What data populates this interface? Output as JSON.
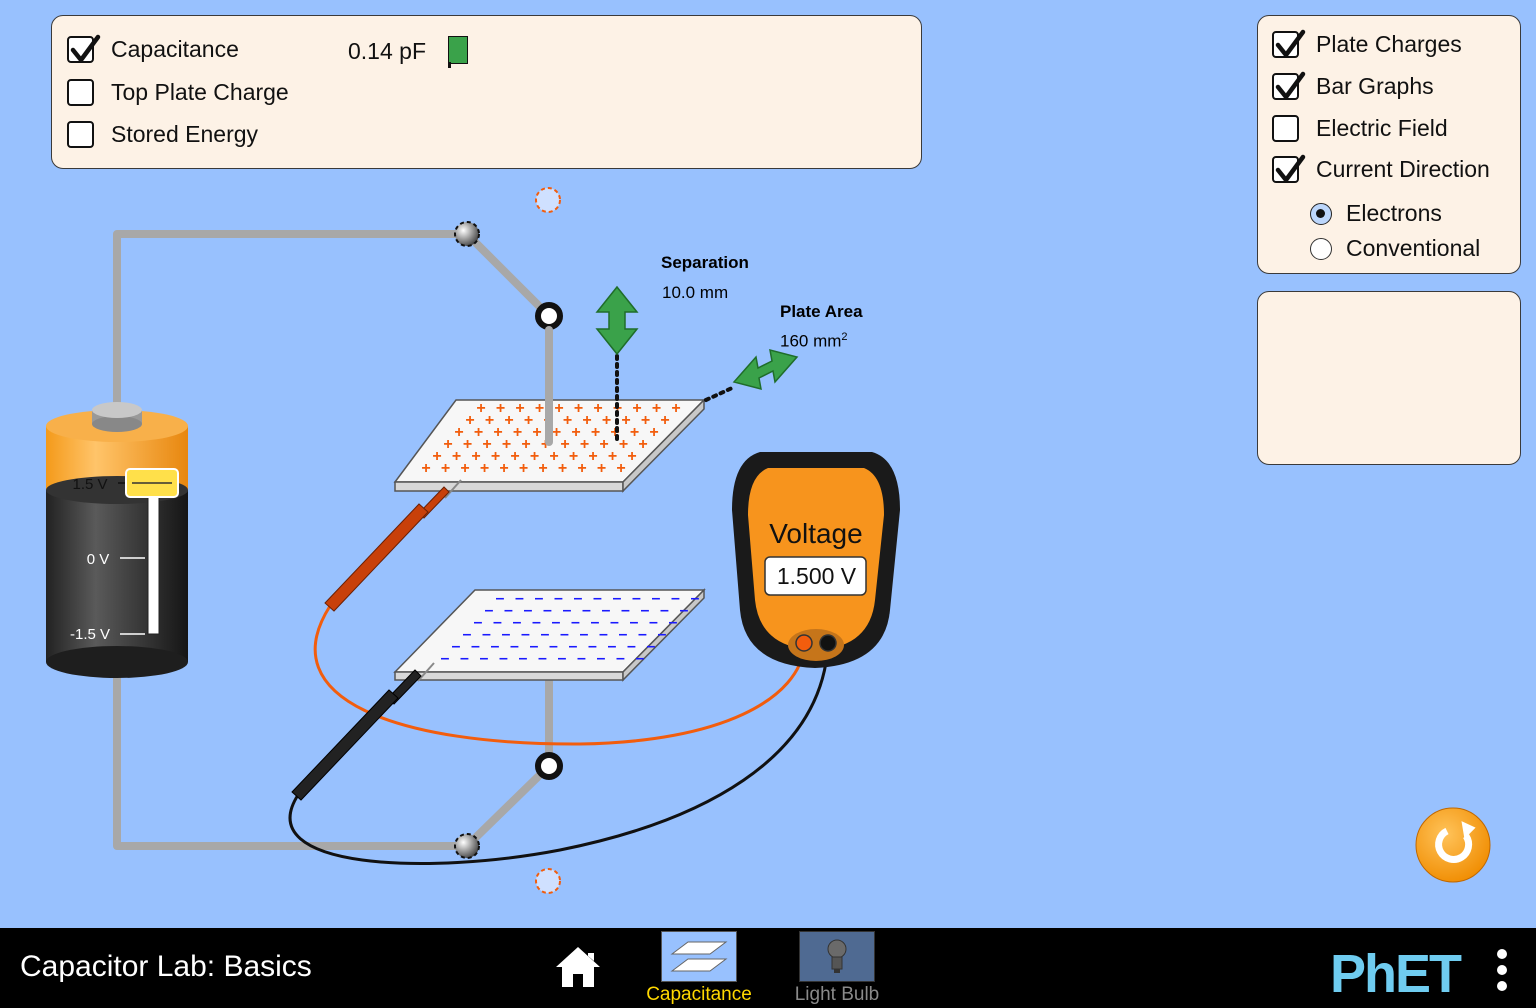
{
  "measure_panel": {
    "items": [
      {
        "label": "Capacitance",
        "checked": true,
        "value": "0.14 pF"
      },
      {
        "label": "Top Plate Charge",
        "checked": false
      },
      {
        "label": "Stored Energy",
        "checked": false
      }
    ]
  },
  "view_panel": {
    "items": [
      {
        "label": "Plate Charges",
        "checked": true
      },
      {
        "label": "Bar Graphs",
        "checked": true
      },
      {
        "label": "Electric Field",
        "checked": false
      },
      {
        "label": "Current Direction",
        "checked": true
      }
    ],
    "current_options": [
      {
        "label": "Electrons",
        "selected": true
      },
      {
        "label": "Conventional",
        "selected": false
      }
    ]
  },
  "battery": {
    "label_top": "1.5 V",
    "label_mid": "0 V",
    "label_bottom": "-1.5 V",
    "voltage_fraction": 1.0
  },
  "separation": {
    "title": "Separation",
    "value": "10.0 mm"
  },
  "plate_area": {
    "title": "Plate Area",
    "value": "160 mm",
    "unit_sup": "2"
  },
  "voltmeter": {
    "title": "Voltage",
    "reading": "1.500 V"
  },
  "navbar": {
    "title": "Capacitor Lab: Basics",
    "screens": [
      {
        "label": "Capacitance",
        "active": true
      },
      {
        "label": "Light Bulb",
        "active": false
      }
    ],
    "logo": "PhET"
  },
  "colors": {
    "background": "#98c1fe",
    "panel": "#fdf2e6",
    "accent_green": "#3aa24a",
    "positive": "#f25d0d",
    "negative": "#1a1aff",
    "active_tab": "#ffd800"
  }
}
